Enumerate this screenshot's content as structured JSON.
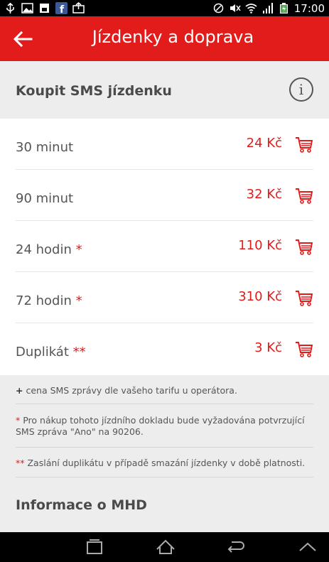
{
  "status_bar": {
    "time": "17:00",
    "left_icons": [
      "usb-icon",
      "image-icon",
      "notification-icon",
      "facebook-icon",
      "upload-icon"
    ],
    "right_icons": [
      "nfc-icon",
      "mute-icon",
      "wifi-icon",
      "signal-icon",
      "battery-icon"
    ]
  },
  "app_bar": {
    "title": "Jízdenky a doprava",
    "back_icon": "back-arrow-icon"
  },
  "section_buy": {
    "title": "Koupit SMS jízdenku",
    "info_label": "i"
  },
  "tickets": [
    {
      "label": "30 minut",
      "star": "",
      "price": "24 Kč"
    },
    {
      "label": "90 minut",
      "star": "",
      "price": "32 Kč"
    },
    {
      "label": "24 hodin",
      "star": "*",
      "price": "110 Kč"
    },
    {
      "label": "72 hodin",
      "star": "*",
      "price": "310 Kč"
    },
    {
      "label": "Duplikát",
      "star": "**",
      "price": "3 Kč"
    }
  ],
  "notes": {
    "plus_sign": "+",
    "note1": "cena SMS zprávy dle vašeho tarifu u operátora.",
    "note2_star": "*",
    "note2": "Pro nákup tohoto jízdního dokladu bude vyžadována potvrzující SMS zpráva \"Ano\" na 90206.",
    "note3_star": "**",
    "note3": "Zaslání duplikátu v případě smazání jízdenky v době platnosti."
  },
  "section_info": {
    "title": "Informace o MHD"
  },
  "colors": {
    "accent": "#e21b1b",
    "section_bg": "#ededed",
    "text": "#555555"
  }
}
